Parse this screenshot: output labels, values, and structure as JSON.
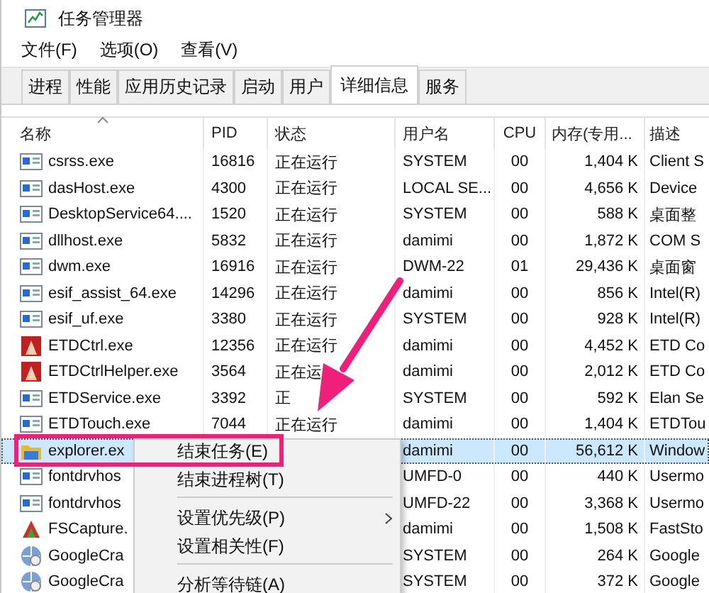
{
  "window": {
    "title": "任务管理器"
  },
  "menu_bar": [
    "文件(F)",
    "选项(O)",
    "查看(V)"
  ],
  "tabs": [
    {
      "label": "进程",
      "selected": false
    },
    {
      "label": "性能",
      "selected": false
    },
    {
      "label": "应用历史记录",
      "selected": false
    },
    {
      "label": "启动",
      "selected": false
    },
    {
      "label": "用户",
      "selected": false
    },
    {
      "label": "详细信息",
      "selected": true
    },
    {
      "label": "服务",
      "selected": false
    }
  ],
  "table": {
    "columns": [
      {
        "label": "名称",
        "sorted": true
      },
      {
        "label": "PID",
        "sorted": false
      },
      {
        "label": "状态",
        "sorted": false
      },
      {
        "label": "用户名",
        "sorted": false
      },
      {
        "label": "CPU",
        "sorted": false
      },
      {
        "label": "内存(专用...",
        "sorted": false
      },
      {
        "label": "描述",
        "sorted": false
      }
    ],
    "rows": [
      {
        "kind": "app",
        "selected": false,
        "cells": [
          "csrss.exe",
          "16816",
          "正在运行",
          "SYSTEM",
          "00",
          "1,404 K",
          "Client S"
        ]
      },
      {
        "kind": "app",
        "selected": false,
        "cells": [
          "dasHost.exe",
          "4300",
          "正在运行",
          "LOCAL SE...",
          "00",
          "4,656 K",
          "Device"
        ]
      },
      {
        "kind": "app",
        "selected": false,
        "cells": [
          "DesktopService64....",
          "1520",
          "正在运行",
          "SYSTEM",
          "00",
          "588 K",
          "桌面整"
        ]
      },
      {
        "kind": "app",
        "selected": false,
        "cells": [
          "dllhost.exe",
          "5832",
          "正在运行",
          "damimi",
          "00",
          "1,872 K",
          "COM S"
        ]
      },
      {
        "kind": "app",
        "selected": false,
        "cells": [
          "dwm.exe",
          "16916",
          "正在运行",
          "DWM-22",
          "01",
          "29,436 K",
          "桌面窗"
        ]
      },
      {
        "kind": "app",
        "selected": false,
        "cells": [
          "esif_assist_64.exe",
          "14296",
          "正在运行",
          "damimi",
          "00",
          "856 K",
          "Intel(R)"
        ]
      },
      {
        "kind": "app",
        "selected": false,
        "cells": [
          "esif_uf.exe",
          "3380",
          "正在运行",
          "SYSTEM",
          "00",
          "928 K",
          "Intel(R)"
        ]
      },
      {
        "kind": "etd",
        "selected": false,
        "cells": [
          "ETDCtrl.exe",
          "12356",
          "正在运行",
          "damimi",
          "00",
          "4,452 K",
          "ETD Co"
        ]
      },
      {
        "kind": "etd",
        "selected": false,
        "cells": [
          "ETDCtrlHelper.exe",
          "3564",
          "正在运",
          "damimi",
          "00",
          "2,012 K",
          "ETD Co"
        ]
      },
      {
        "kind": "app",
        "selected": false,
        "cells": [
          "ETDService.exe",
          "3392",
          "正",
          "SYSTEM",
          "00",
          "592 K",
          "Elan Se"
        ]
      },
      {
        "kind": "app",
        "selected": false,
        "cells": [
          "ETDTouch.exe",
          "7044",
          "正在运行",
          "damimi",
          "00",
          "1,404 K",
          "ETDTou"
        ]
      },
      {
        "kind": "folder",
        "selected": true,
        "cells": [
          "explorer.ex",
          "",
          "",
          "damimi",
          "00",
          "56,612 K",
          "Window"
        ]
      },
      {
        "kind": "app",
        "selected": false,
        "cells": [
          "fontdrvhos",
          "",
          "",
          "UMFD-0",
          "00",
          "440 K",
          "Usermo"
        ]
      },
      {
        "kind": "app",
        "selected": false,
        "cells": [
          "fontdrvhos",
          "",
          "",
          "UMFD-22",
          "00",
          "3,368 K",
          "Usermo"
        ]
      },
      {
        "kind": "capture",
        "selected": false,
        "cells": [
          "FSCapture.",
          "",
          "",
          "damimi",
          "00",
          "1,508 K",
          "FastSto"
        ]
      },
      {
        "kind": "globe",
        "selected": false,
        "cells": [
          "GoogleCra",
          "",
          "",
          "SYSTEM",
          "00",
          "264 K",
          "Google"
        ]
      },
      {
        "kind": "globe",
        "selected": false,
        "cells": [
          "GoogleCra",
          "",
          "",
          "SYSTEM",
          "00",
          "372 K",
          "Google"
        ]
      }
    ]
  },
  "context_menu": [
    {
      "label": "结束任务(E)",
      "submenu": false,
      "separator_after": false
    },
    {
      "label": "结束进程树(T)",
      "submenu": false,
      "separator_after": true
    },
    {
      "label": "设置优先级(P)",
      "submenu": true,
      "separator_after": false
    },
    {
      "label": "设置相关性(F)",
      "submenu": false,
      "separator_after": true
    },
    {
      "label": "分析等待链(A)",
      "submenu": false,
      "separator_after": false
    }
  ],
  "annotation": {
    "highlight_frame": true,
    "pointer_arrow": true
  }
}
